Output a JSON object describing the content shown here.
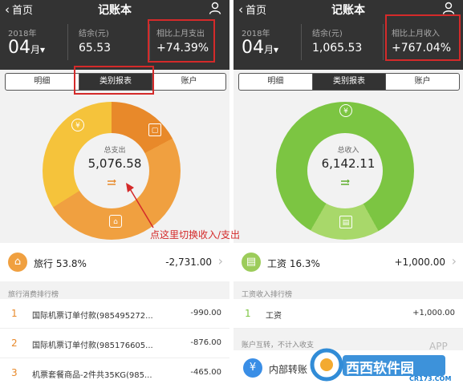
{
  "left": {
    "nav": {
      "back_label": "首页",
      "title": "记账本"
    },
    "header": {
      "year": "2018年",
      "month": "04",
      "month_suffix": "月▾",
      "balance_label": "结余(元)",
      "balance_value": "65.53",
      "compare_label": "相比上月支出",
      "compare_value": "+74.39%"
    },
    "tabs": [
      "明细",
      "类别报表",
      "账户"
    ],
    "active_tab": 1,
    "ring": {
      "center_label": "总支出",
      "center_value": "5,076.58",
      "colors": [
        "#f5c33b",
        "#f0a040",
        "#e8892a"
      ]
    },
    "detail": {
      "label": "旅行 53.8%",
      "amount": "-2,731.00",
      "icon": "lock-icon",
      "icon_color": "#f0a040"
    },
    "rank_title": "旅行消费排行榜",
    "rank": [
      {
        "num": "1",
        "name": "国际机票订单付款(985495272...",
        "amount": "-990.00"
      },
      {
        "num": "2",
        "name": "国际机票订单付款(985176605...",
        "amount": "-876.00"
      },
      {
        "num": "3",
        "name": "机票套餐商品-2件共35KG(985...",
        "amount": "-465.00"
      }
    ],
    "annotation": "点这里切换收入/支出"
  },
  "right": {
    "nav": {
      "back_label": "首页",
      "title": "记账本"
    },
    "header": {
      "year": "2018年",
      "month": "04",
      "month_suffix": "月▾",
      "balance_label": "结余(元)",
      "balance_value": "1,065.53",
      "compare_label": "相比上月收入",
      "compare_value": "+767.04%"
    },
    "tabs": [
      "明细",
      "类别报表",
      "账户"
    ],
    "active_tab": 1,
    "ring": {
      "center_label": "总收入",
      "center_value": "6,142.11",
      "colors": [
        "#7cc542",
        "#a8d86a"
      ]
    },
    "detail": {
      "label": "工资 16.3%",
      "amount": "+1,000.00",
      "icon": "briefcase-icon",
      "icon_color": "#9ccc5a"
    },
    "rank_title": "工资收入排行榜",
    "rank": [
      {
        "num": "1",
        "name": "工资",
        "amount": "+1,000.00"
      }
    ],
    "section2_title": "账户互转，不计入收支",
    "transfer": {
      "name": "内部转账",
      "icon": "transfer-icon"
    }
  },
  "watermark": {
    "brand": "西西软件园",
    "url": "CR173.COM",
    "badge": "APP"
  }
}
